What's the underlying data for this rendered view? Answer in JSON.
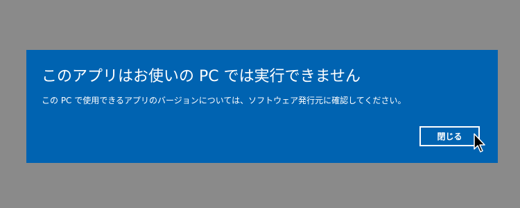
{
  "dialog": {
    "title": "このアプリはお使いの PC では実行できません",
    "message": "この PC で使用できるアプリのバージョンについては、ソフトウェア発行元に確認してください。",
    "close_label": "閉じる"
  },
  "colors": {
    "backdrop": "#8a8a8a",
    "dialog_background": "#0063b1",
    "text": "#ffffff"
  },
  "cursor": {
    "icon": "arrow-pointer-icon"
  }
}
